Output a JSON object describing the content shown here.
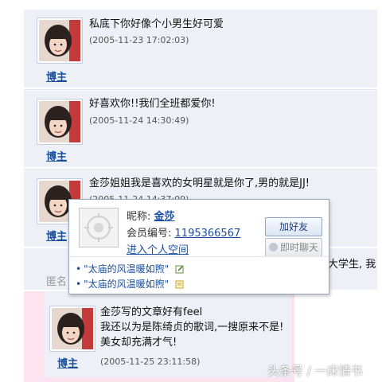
{
  "comments": [
    {
      "author": "博主",
      "text_lines": [
        "私底下你好像个小男生好可爱"
      ],
      "time": "(2005-11-23 17:02:03)"
    },
    {
      "author": "博主",
      "text_lines": [
        "好喜欢你!!我们全班都爱你!"
      ],
      "time": "(2005-11-24 14:30:49)"
    },
    {
      "author": "博主",
      "text_lines": [
        "金莎姐姐我是喜欢的女明星就是你了,男的就是JJ!"
      ],
      "time": "(2005-11-24 14:37:09)"
    },
    {
      "author": "",
      "text_lines": [
        "大学生, 我"
      ],
      "time": ""
    },
    {
      "author": "博主",
      "text_lines": [
        "金莎写的文章好有feel",
        "我还以为是陈绮贞的歌词,一搜原来不是!",
        "美女却充满才气!"
      ],
      "time": "(2005-11-25 23:11:58)"
    }
  ],
  "hidden_name_fragment": "匿名",
  "popup": {
    "nickname_label": "昵称:",
    "nickname": "金莎",
    "member_label": "会员编号:",
    "member_id": "1195366567",
    "space_link": "进入个人空间",
    "add_friend_button": "加好友",
    "chat_button": "即时聊天",
    "links": [
      "\"太庙的风温暖如煦\"",
      "\"太庙的风温暖如煦\""
    ]
  },
  "watermark": "头条号 / 一床情书",
  "colors": {
    "link": "#1a4fa0",
    "comment_bg": "#edf1f7",
    "pink_highlight": "#fbe3ef"
  }
}
